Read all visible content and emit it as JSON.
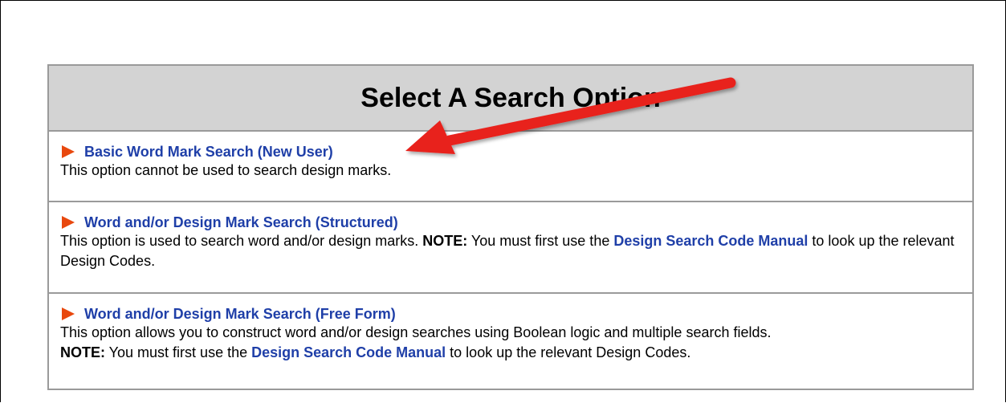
{
  "header": {
    "title": "Select A Search Option"
  },
  "options": [
    {
      "title": "Basic Word Mark Search (New User)",
      "desc_text": "This option cannot be used to search design marks."
    },
    {
      "title": "Word and/or Design Mark Search (Structured)",
      "desc_pre": "This option is used to search word and/or design marks. ",
      "note_label": "NOTE:",
      "desc_mid": " You must first use the ",
      "link_text": "Design Search Code Manual",
      "desc_post": " to look up the relevant Design Codes."
    },
    {
      "title": "Word and/or Design Mark Search (Free Form)",
      "desc_pre": "This option allows you to construct word and/or design searches using Boolean logic and multiple search fields.",
      "note_label": "NOTE:",
      "desc_mid": " You must first use the ",
      "link_text": "Design Search Code Manual",
      "desc_post": " to look up the relevant Design Codes."
    }
  ],
  "colors": {
    "link": "#1f3fa8",
    "bullet": "#e8480e",
    "header_bg": "#d3d3d3",
    "annotation_arrow": "#e8201c"
  },
  "icons": {
    "bullet": "orange-triangle-bullet-icon",
    "annotation": "red-arrow-annotation-icon"
  }
}
